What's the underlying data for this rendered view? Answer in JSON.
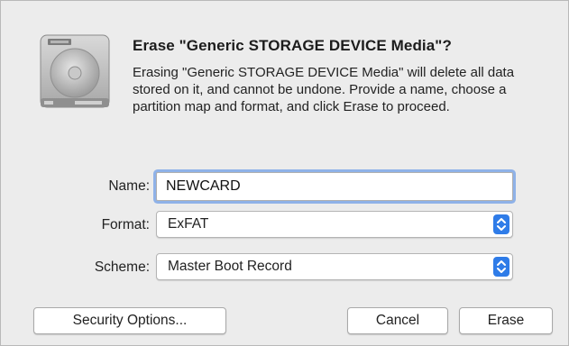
{
  "dialog": {
    "title": "Erase \"Generic STORAGE DEVICE Media\"?",
    "message": "Erasing \"Generic STORAGE DEVICE Media\" will delete all data stored on it, and cannot be undone. Provide a name, choose a partition map and format, and click Erase to proceed.",
    "icon": "external-drive-icon"
  },
  "form": {
    "name_label": "Name:",
    "name_value": "NEWCARD",
    "format_label": "Format:",
    "format_value": "ExFAT",
    "scheme_label": "Scheme:",
    "scheme_value": "Master Boot Record"
  },
  "buttons": {
    "security": "Security Options...",
    "cancel": "Cancel",
    "erase": "Erase"
  },
  "colors": {
    "accent": "#2f7ce8",
    "focus_ring": "#8fb2e8",
    "dialog_bg": "#ececec"
  }
}
